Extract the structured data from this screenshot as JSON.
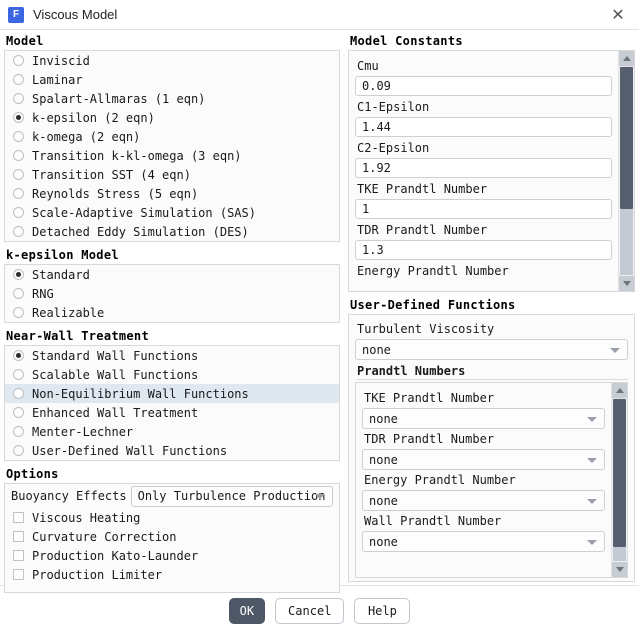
{
  "window": {
    "title": "Viscous Model",
    "icon_letter": "F",
    "icon_name": "fluent-app-icon",
    "close_label": "✕",
    "accent": "#3b68e0",
    "primary_button_bg": "#4e5765",
    "hover_highlight": "#dfe7f1"
  },
  "model": {
    "title": "Model",
    "items": [
      {
        "label": "Inviscid",
        "selected": false
      },
      {
        "label": "Laminar",
        "selected": false
      },
      {
        "label": "Spalart-Allmaras (1 eqn)",
        "selected": false
      },
      {
        "label": "k-epsilon (2 eqn)",
        "selected": true
      },
      {
        "label": "k-omega (2 eqn)",
        "selected": false
      },
      {
        "label": "Transition k-kl-omega (3 eqn)",
        "selected": false
      },
      {
        "label": "Transition SST (4 eqn)",
        "selected": false
      },
      {
        "label": "Reynolds Stress (5 eqn)",
        "selected": false
      },
      {
        "label": "Scale-Adaptive Simulation (SAS)",
        "selected": false
      },
      {
        "label": "Detached Eddy Simulation (DES)",
        "selected": false
      }
    ]
  },
  "ke_model": {
    "title": "k-epsilon Model",
    "items": [
      {
        "label": "Standard",
        "selected": true
      },
      {
        "label": "RNG",
        "selected": false
      },
      {
        "label": "Realizable",
        "selected": false
      }
    ]
  },
  "near_wall": {
    "title": "Near-Wall Treatment",
    "items": [
      {
        "label": "Standard Wall Functions",
        "selected": true,
        "hovered": false
      },
      {
        "label": "Scalable Wall Functions",
        "selected": false,
        "hovered": false
      },
      {
        "label": "Non-Equilibrium Wall Functions",
        "selected": false,
        "hovered": true
      },
      {
        "label": "Enhanced Wall Treatment",
        "selected": false,
        "hovered": false
      },
      {
        "label": "Menter-Lechner",
        "selected": false,
        "hovered": false
      },
      {
        "label": "User-Defined Wall Functions",
        "selected": false,
        "hovered": false
      }
    ]
  },
  "options": {
    "title": "Options",
    "buoyancy_label": "Buoyancy Effects",
    "buoyancy_value": "Only Turbulence Production",
    "checkboxes": [
      {
        "label": "Viscous Heating",
        "checked": false
      },
      {
        "label": "Curvature Correction",
        "checked": false
      },
      {
        "label": "Production Kato-Launder",
        "checked": false
      },
      {
        "label": "Production Limiter",
        "checked": false
      }
    ]
  },
  "model_constants": {
    "title": "Model Constants",
    "fields": [
      {
        "label": "Cmu",
        "value": "0.09"
      },
      {
        "label": "C1-Epsilon",
        "value": "1.44"
      },
      {
        "label": "C2-Epsilon",
        "value": "1.92"
      },
      {
        "label": "TKE Prandtl Number",
        "value": "1"
      },
      {
        "label": "TDR Prandtl Number",
        "value": "1.3"
      }
    ],
    "clipped_label": "Energy Prandtl Number"
  },
  "udf": {
    "title": "User-Defined Functions",
    "turbulent_viscosity_label": "Turbulent Viscosity",
    "turbulent_viscosity_value": "none",
    "prandtl_title": "Prandtl Numbers",
    "prandtl_fields": [
      {
        "label": "TKE Prandtl Number",
        "value": "none"
      },
      {
        "label": "TDR Prandtl Number",
        "value": "none"
      },
      {
        "label": "Energy Prandtl Number",
        "value": "none"
      },
      {
        "label": "Wall Prandtl Number",
        "value": "none"
      }
    ]
  },
  "footer": {
    "ok": "OK",
    "cancel": "Cancel",
    "help": "Help"
  }
}
